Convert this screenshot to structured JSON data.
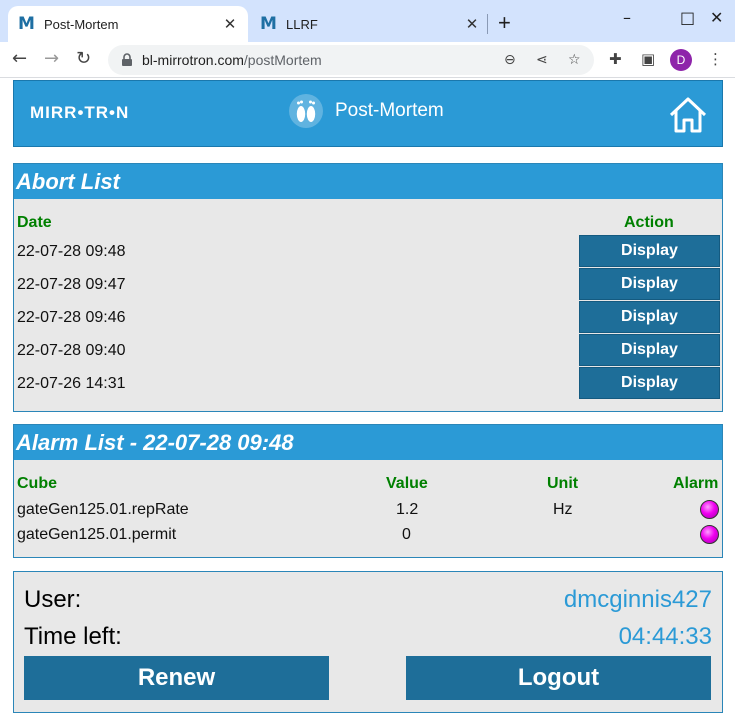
{
  "browser": {
    "tabs": [
      {
        "favicon": "M",
        "title": "Post-Mortem",
        "close": "✕"
      },
      {
        "favicon": "M",
        "title": "LLRF",
        "close": "✕"
      }
    ],
    "new_tab": "+",
    "window_controls": {
      "minimize": "–",
      "maximize": "□",
      "close": "✕"
    },
    "url_host": "bl-mirrotron.com",
    "url_path": "/postMortem",
    "profile_initial": "D"
  },
  "header": {
    "logo": "MIRR•TR•N",
    "title": "Post-Mortem"
  },
  "abort_list": {
    "title": "Abort List",
    "col_date": "Date",
    "col_action": "Action",
    "rows": [
      {
        "date": "22-07-28 09:48",
        "action": "Display"
      },
      {
        "date": "22-07-28 09:47",
        "action": "Display"
      },
      {
        "date": "22-07-28 09:46",
        "action": "Display"
      },
      {
        "date": "22-07-28 09:40",
        "action": "Display"
      },
      {
        "date": "22-07-26 14:31",
        "action": "Display"
      }
    ]
  },
  "alarm_list": {
    "title": "Alarm List - 22-07-28 09:48",
    "col_cube": "Cube",
    "col_value": "Value",
    "col_unit": "Unit",
    "col_alarm": "Alarm",
    "alarm_color": "#f000f0",
    "rows": [
      {
        "cube": "gateGen125.01.repRate",
        "value": "1.2",
        "unit": "Hz"
      },
      {
        "cube": "gateGen125.01.permit",
        "value": "0",
        "unit": ""
      }
    ]
  },
  "session": {
    "user_label": "User:",
    "user": "dmcginnis427",
    "time_label": "Time left:",
    "time_left": "04:44:33",
    "renew": "Renew",
    "logout": "Logout"
  },
  "colors": {
    "accent": "#2b9ad6",
    "button": "#1e6e99",
    "header_text": "#008000"
  }
}
